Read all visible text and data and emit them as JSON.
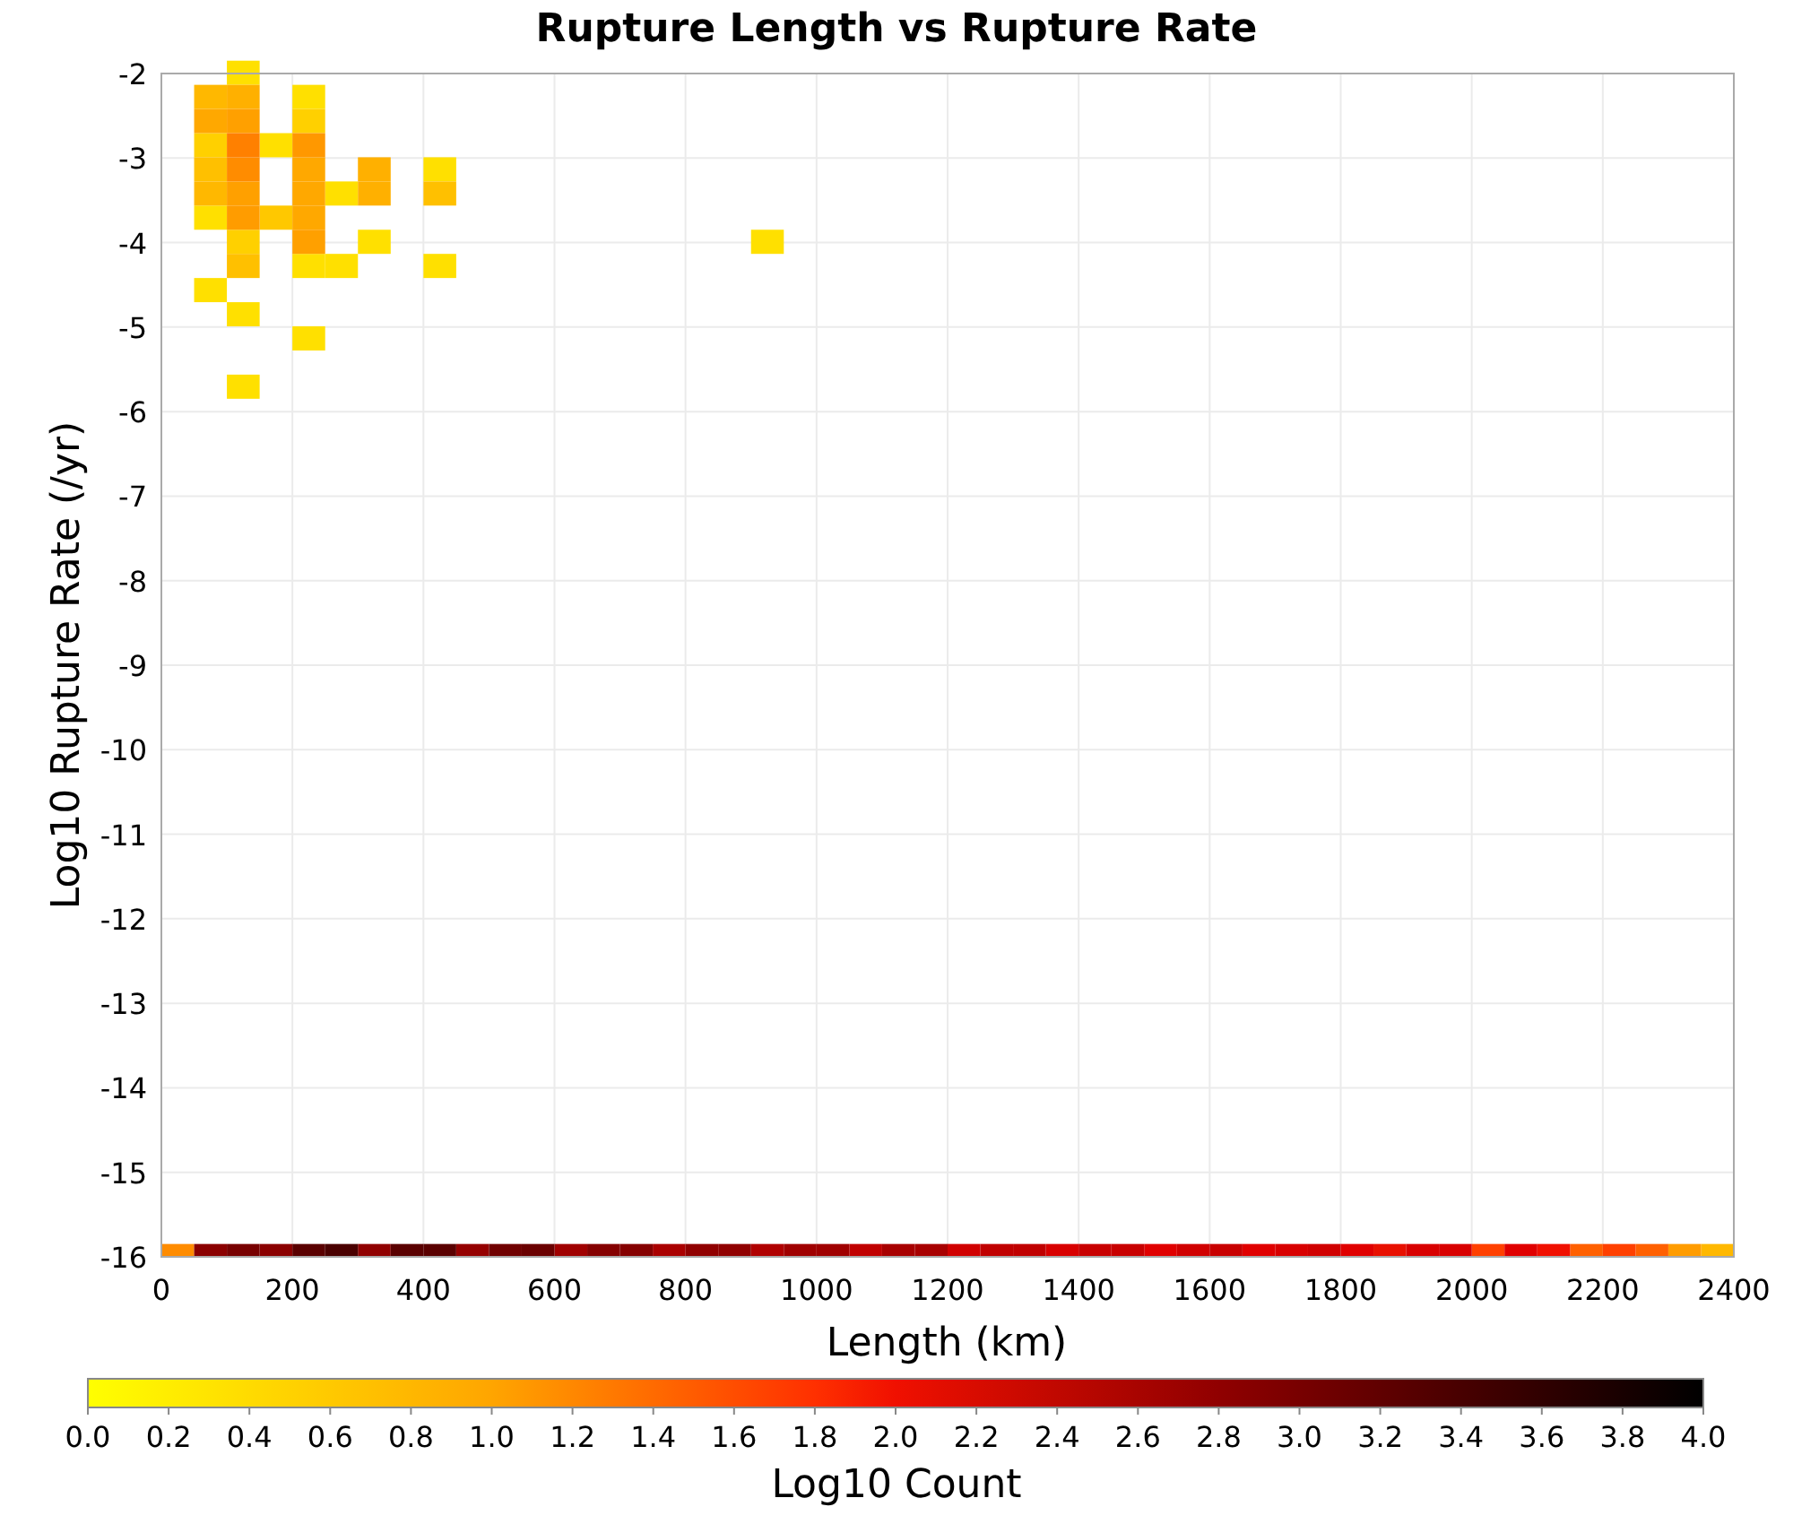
{
  "chart_data": {
    "type": "scatter",
    "title": "Rupture Length vs Rupture Rate",
    "xlabel": "Length (km)",
    "ylabel": "Log10 Rupture Rate (/yr)",
    "xlim": [
      0,
      2400
    ],
    "ylim": [
      -16,
      -2
    ],
    "grid": true,
    "xticks": [
      0,
      200,
      400,
      600,
      800,
      1000,
      1200,
      1400,
      1600,
      1800,
      2000,
      2200,
      2400
    ],
    "yticks": [
      -2,
      -3,
      -4,
      -5,
      -6,
      -7,
      -8,
      -9,
      -10,
      -11,
      -12,
      -13,
      -14,
      -15,
      -16
    ],
    "x": [
      25,
      75,
      125,
      175,
      225,
      275,
      325,
      375,
      425,
      475,
      525,
      575,
      625,
      675,
      725,
      775,
      825,
      875,
      925,
      975,
      1025,
      1075,
      1125,
      1175,
      1225,
      1275,
      1325,
      1375,
      1425,
      1475,
      1525,
      1575,
      1625,
      1675,
      1725,
      1775,
      1825,
      1875,
      1925,
      1975,
      2025,
      2075,
      2125,
      2175,
      2225,
      2275,
      2325,
      2375
    ],
    "series": [
      {
        "color": "#ffe000",
        "values": [
          null,
          -3.71,
          -2,
          -2.85,
          -2.28,
          -3.42,
          -3.99,
          null,
          -3.13,
          null,
          null,
          null,
          null,
          null,
          null,
          null,
          null,
          null,
          -3.99,
          null,
          null,
          null,
          null,
          null,
          null,
          null,
          null,
          null,
          null,
          null,
          null,
          null,
          null,
          null,
          null,
          null,
          null,
          null,
          null,
          null,
          null,
          null,
          null,
          null,
          null,
          null,
          null,
          null
        ]
      },
      {
        "color": "#ffe000",
        "values": [
          null,
          -4.56,
          -4.85,
          null,
          -4.28,
          -4.28,
          null,
          null,
          -4.28,
          null,
          null,
          null,
          null,
          null,
          null,
          null,
          null,
          null,
          null,
          null,
          null,
          null,
          null,
          null,
          null,
          null,
          null,
          null,
          null,
          null,
          null,
          null,
          null,
          null,
          null,
          null,
          null,
          null,
          null,
          null,
          null,
          null,
          null,
          null,
          null,
          null,
          null,
          null
        ]
      },
      {
        "color": "#ffe000",
        "values": [
          null,
          null,
          -5.7,
          null,
          -5.13,
          null,
          null,
          null,
          null,
          null,
          null,
          null,
          null,
          null,
          null,
          null,
          null,
          null,
          null,
          null,
          null,
          null,
          null,
          null,
          null,
          null,
          null,
          null,
          null,
          null,
          null,
          null,
          null,
          null,
          null,
          null,
          null,
          null,
          null,
          null,
          null,
          null,
          null,
          null,
          null,
          null,
          null,
          null
        ]
      },
      {
        "color": "#ffd000",
        "values": [
          null,
          -2.85,
          -3.99,
          null,
          -2.56,
          null,
          null,
          null,
          null,
          null,
          null,
          null,
          null,
          null,
          null,
          null,
          null,
          null,
          null,
          null,
          null,
          null,
          null,
          null,
          null,
          null,
          null,
          null,
          null,
          null,
          null,
          null,
          null,
          null,
          null,
          null,
          null,
          null,
          null,
          null,
          null,
          null,
          null,
          null,
          null,
          null,
          null,
          null
        ]
      },
      {
        "color": "#ffc800",
        "values": [
          null,
          null,
          null,
          -3.71,
          null,
          null,
          null,
          null,
          null,
          null,
          null,
          null,
          null,
          null,
          null,
          null,
          null,
          null,
          null,
          null,
          null,
          null,
          null,
          null,
          null,
          null,
          null,
          null,
          null,
          null,
          null,
          null,
          null,
          null,
          null,
          null,
          null,
          null,
          null,
          null,
          null,
          null,
          null,
          null,
          null,
          null,
          null,
          null
        ]
      },
      {
        "color": "#ffc000",
        "values": [
          null,
          -3.13,
          -4.28,
          null,
          null,
          null,
          null,
          null,
          -3.42,
          null,
          null,
          null,
          null,
          null,
          null,
          null,
          null,
          null,
          null,
          null,
          null,
          null,
          null,
          null,
          null,
          null,
          null,
          null,
          null,
          null,
          null,
          null,
          null,
          null,
          null,
          null,
          null,
          null,
          null,
          null,
          null,
          null,
          null,
          null,
          null,
          null,
          null,
          null
        ]
      },
      {
        "color": "#ffb800",
        "values": [
          null,
          -2.28,
          null,
          null,
          null,
          null,
          null,
          null,
          null,
          null,
          null,
          null,
          null,
          null,
          null,
          null,
          null,
          null,
          null,
          null,
          null,
          null,
          null,
          null,
          null,
          null,
          null,
          null,
          null,
          null,
          null,
          null,
          null,
          null,
          null,
          null,
          null,
          null,
          null,
          null,
          null,
          null,
          null,
          null,
          null,
          null,
          null,
          -15.92
        ]
      },
      {
        "color": "#ffb800",
        "values": [
          null,
          -3.42,
          null,
          null,
          null,
          null,
          null,
          null,
          null,
          null,
          null,
          null,
          null,
          null,
          null,
          null,
          null,
          null,
          null,
          null,
          null,
          null,
          null,
          null,
          null,
          null,
          null,
          null,
          null,
          null,
          null,
          null,
          null,
          null,
          null,
          null,
          null,
          null,
          null,
          null,
          null,
          null,
          null,
          null,
          null,
          null,
          null,
          null
        ]
      },
      {
        "color": "#ffb000",
        "values": [
          null,
          null,
          -2.28,
          null,
          null,
          null,
          -3.13,
          null,
          null,
          null,
          null,
          null,
          null,
          null,
          null,
          null,
          null,
          null,
          null,
          null,
          null,
          null,
          null,
          null,
          null,
          null,
          null,
          null,
          null,
          null,
          null,
          null,
          null,
          null,
          null,
          null,
          null,
          null,
          null,
          null,
          null,
          null,
          null,
          null,
          null,
          null,
          null,
          null
        ]
      },
      {
        "color": "#ffb000",
        "values": [
          null,
          null,
          null,
          null,
          null,
          null,
          -3.42,
          null,
          null,
          null,
          null,
          null,
          null,
          null,
          null,
          null,
          null,
          null,
          null,
          null,
          null,
          null,
          null,
          null,
          null,
          null,
          null,
          null,
          null,
          null,
          null,
          null,
          null,
          null,
          null,
          null,
          null,
          null,
          null,
          null,
          null,
          null,
          null,
          null,
          null,
          null,
          null,
          null
        ]
      },
      {
        "color": "#ffa800",
        "values": [
          null,
          -2.56,
          null,
          null,
          -3.13,
          null,
          null,
          null,
          null,
          null,
          null,
          null,
          null,
          null,
          null,
          null,
          null,
          null,
          null,
          null,
          null,
          null,
          null,
          null,
          null,
          null,
          null,
          null,
          null,
          null,
          null,
          null,
          null,
          null,
          null,
          null,
          null,
          null,
          null,
          null,
          null,
          null,
          null,
          null,
          null,
          null,
          null,
          null
        ]
      },
      {
        "color": "#ffa800",
        "values": [
          null,
          null,
          null,
          null,
          -3.42,
          null,
          null,
          null,
          null,
          null,
          null,
          null,
          null,
          null,
          null,
          null,
          null,
          null,
          null,
          null,
          null,
          null,
          null,
          null,
          null,
          null,
          null,
          null,
          null,
          null,
          null,
          null,
          null,
          null,
          null,
          null,
          null,
          null,
          null,
          null,
          null,
          null,
          null,
          null,
          null,
          null,
          null,
          null
        ]
      },
      {
        "color": "#ffa800",
        "values": [
          null,
          null,
          null,
          null,
          -3.71,
          null,
          null,
          null,
          null,
          null,
          null,
          null,
          null,
          null,
          null,
          null,
          null,
          null,
          null,
          null,
          null,
          null,
          null,
          null,
          null,
          null,
          null,
          null,
          null,
          null,
          null,
          null,
          null,
          null,
          null,
          null,
          null,
          null,
          null,
          null,
          null,
          null,
          null,
          null,
          null,
          null,
          null,
          null
        ]
      },
      {
        "color": "#ffa000",
        "values": [
          null,
          null,
          -2.56,
          null,
          -3.99,
          null,
          null,
          null,
          null,
          null,
          null,
          null,
          null,
          null,
          null,
          null,
          null,
          null,
          null,
          null,
          null,
          null,
          null,
          null,
          null,
          null,
          null,
          null,
          null,
          null,
          null,
          null,
          null,
          null,
          null,
          null,
          null,
          null,
          null,
          null,
          null,
          null,
          null,
          null,
          null,
          null,
          null,
          null
        ]
      },
      {
        "color": "#ffa000",
        "values": [
          null,
          null,
          -3.42,
          null,
          null,
          null,
          null,
          null,
          null,
          null,
          null,
          null,
          null,
          null,
          null,
          null,
          null,
          null,
          null,
          null,
          null,
          null,
          null,
          null,
          null,
          null,
          null,
          null,
          null,
          null,
          null,
          null,
          null,
          null,
          null,
          null,
          null,
          null,
          null,
          null,
          null,
          null,
          null,
          null,
          null,
          null,
          null,
          null
        ]
      },
      {
        "color": "#ff9c00",
        "values": [
          null,
          null,
          -3.71,
          null,
          null,
          null,
          null,
          null,
          null,
          null,
          null,
          null,
          null,
          null,
          null,
          null,
          null,
          null,
          null,
          null,
          null,
          null,
          null,
          null,
          null,
          null,
          null,
          null,
          null,
          null,
          null,
          null,
          null,
          null,
          null,
          null,
          null,
          null,
          null,
          null,
          null,
          null,
          null,
          null,
          null,
          null,
          -15.92,
          null
        ]
      },
      {
        "color": "#ff9800",
        "values": [
          null,
          null,
          null,
          null,
          -2.85,
          null,
          null,
          null,
          null,
          null,
          null,
          null,
          null,
          null,
          null,
          null,
          null,
          null,
          null,
          null,
          null,
          null,
          null,
          null,
          null,
          null,
          null,
          null,
          null,
          null,
          null,
          null,
          null,
          null,
          null,
          null,
          null,
          null,
          null,
          null,
          null,
          null,
          null,
          null,
          null,
          null,
          null,
          null
        ]
      },
      {
        "color": "#ff8c00",
        "values": [
          -15.92,
          null,
          -3.13,
          null,
          null,
          null,
          null,
          null,
          null,
          null,
          null,
          null,
          null,
          null,
          null,
          null,
          null,
          null,
          null,
          null,
          null,
          null,
          null,
          null,
          null,
          null,
          null,
          null,
          null,
          null,
          null,
          null,
          null,
          null,
          null,
          null,
          null,
          null,
          null,
          null,
          null,
          null,
          null,
          null,
          null,
          null,
          null,
          null
        ]
      },
      {
        "color": "#ff8000",
        "values": [
          null,
          null,
          -2.85,
          null,
          null,
          null,
          null,
          null,
          null,
          null,
          null,
          null,
          null,
          null,
          null,
          null,
          null,
          null,
          null,
          null,
          null,
          null,
          null,
          null,
          null,
          null,
          null,
          null,
          null,
          null,
          null,
          null,
          null,
          null,
          null,
          null,
          null,
          null,
          null,
          null,
          null,
          null,
          null,
          null,
          null,
          null,
          null,
          null
        ]
      },
      {
        "color": "#ff6000",
        "values": [
          null,
          null,
          null,
          null,
          null,
          null,
          null,
          null,
          null,
          null,
          null,
          null,
          null,
          null,
          null,
          null,
          null,
          null,
          null,
          null,
          null,
          null,
          null,
          null,
          null,
          null,
          null,
          null,
          null,
          null,
          null,
          null,
          null,
          null,
          null,
          null,
          null,
          null,
          null,
          null,
          null,
          null,
          null,
          -15.92,
          null,
          -15.92,
          null,
          null
        ]
      },
      {
        "color": "#ff4000",
        "values": [
          null,
          null,
          null,
          null,
          null,
          null,
          null,
          null,
          null,
          null,
          null,
          null,
          null,
          null,
          null,
          null,
          null,
          null,
          null,
          null,
          null,
          null,
          null,
          null,
          null,
          null,
          null,
          null,
          null,
          null,
          null,
          null,
          null,
          null,
          null,
          null,
          null,
          null,
          null,
          null,
          -15.92,
          null,
          null,
          null,
          -15.92,
          null,
          null,
          null
        ]
      },
      {
        "color": "#f01000",
        "values": [
          null,
          null,
          null,
          null,
          null,
          null,
          null,
          null,
          null,
          null,
          null,
          null,
          null,
          null,
          null,
          null,
          null,
          null,
          null,
          null,
          null,
          null,
          null,
          null,
          null,
          null,
          null,
          null,
          null,
          null,
          null,
          null,
          null,
          null,
          null,
          null,
          null,
          null,
          null,
          null,
          null,
          null,
          -15.92,
          null,
          null,
          null,
          null,
          null
        ]
      },
      {
        "color": "#e81000",
        "values": [
          null,
          null,
          null,
          null,
          null,
          null,
          null,
          null,
          null,
          null,
          null,
          null,
          null,
          null,
          null,
          null,
          null,
          null,
          null,
          null,
          null,
          null,
          null,
          null,
          null,
          null,
          null,
          null,
          null,
          null,
          null,
          null,
          null,
          null,
          null,
          null,
          null,
          -15.92,
          null,
          null,
          null,
          null,
          null,
          null,
          null,
          null,
          null,
          null
        ]
      },
      {
        "color": "#e00000",
        "values": [
          null,
          null,
          null,
          null,
          null,
          null,
          null,
          null,
          null,
          null,
          null,
          null,
          null,
          null,
          null,
          null,
          null,
          null,
          null,
          null,
          null,
          null,
          null,
          null,
          null,
          null,
          null,
          null,
          null,
          null,
          -15.92,
          null,
          null,
          -15.92,
          null,
          null,
          -15.92,
          null,
          null,
          null,
          null,
          -15.92,
          null,
          null,
          null,
          null,
          null,
          null
        ]
      },
      {
        "color": "#d80000",
        "values": [
          null,
          null,
          null,
          null,
          null,
          null,
          null,
          null,
          null,
          null,
          null,
          null,
          null,
          null,
          null,
          null,
          null,
          null,
          null,
          null,
          null,
          null,
          null,
          null,
          null,
          null,
          null,
          -15.92,
          null,
          null,
          null,
          null,
          null,
          null,
          -15.92,
          null,
          null,
          null,
          -15.92,
          -15.92,
          null,
          null,
          null,
          null,
          null,
          null,
          null,
          null
        ]
      },
      {
        "color": "#d00000",
        "values": [
          null,
          null,
          null,
          null,
          null,
          null,
          null,
          null,
          null,
          null,
          null,
          null,
          null,
          null,
          null,
          null,
          null,
          null,
          null,
          null,
          null,
          null,
          null,
          null,
          -15.92,
          null,
          null,
          null,
          null,
          null,
          null,
          -15.92,
          null,
          null,
          null,
          -15.92,
          null,
          null,
          null,
          null,
          null,
          null,
          null,
          null,
          null,
          null,
          null,
          null
        ]
      },
      {
        "color": "#c80000",
        "values": [
          null,
          null,
          null,
          null,
          null,
          null,
          null,
          null,
          null,
          null,
          null,
          null,
          null,
          null,
          null,
          null,
          null,
          null,
          null,
          null,
          null,
          null,
          null,
          null,
          null,
          null,
          null,
          null,
          -15.92,
          -15.92,
          null,
          null,
          -15.92,
          null,
          null,
          null,
          null,
          null,
          null,
          null,
          null,
          null,
          null,
          null,
          null,
          null,
          null,
          null
        ]
      },
      {
        "color": "#c00000",
        "values": [
          null,
          null,
          null,
          null,
          null,
          null,
          null,
          null,
          null,
          null,
          null,
          null,
          null,
          null,
          null,
          null,
          null,
          null,
          null,
          null,
          null,
          -15.92,
          null,
          null,
          null,
          -15.92,
          -15.92,
          null,
          null,
          null,
          null,
          null,
          null,
          null,
          null,
          null,
          null,
          null,
          null,
          null,
          null,
          null,
          null,
          null,
          null,
          null,
          null,
          null
        ]
      },
      {
        "color": "#b00000",
        "values": [
          null,
          null,
          null,
          null,
          null,
          null,
          null,
          null,
          null,
          null,
          null,
          null,
          null,
          null,
          null,
          null,
          null,
          null,
          -15.92,
          null,
          null,
          null,
          null,
          null,
          null,
          null,
          null,
          null,
          null,
          null,
          null,
          null,
          null,
          null,
          null,
          null,
          null,
          null,
          null,
          null,
          null,
          null,
          null,
          null,
          null,
          null,
          null,
          null
        ]
      },
      {
        "color": "#aa0000",
        "values": [
          null,
          null,
          null,
          null,
          null,
          null,
          null,
          null,
          null,
          null,
          null,
          null,
          null,
          null,
          null,
          -15.92,
          null,
          null,
          null,
          null,
          null,
          null,
          null,
          null,
          null,
          null,
          null,
          null,
          null,
          null,
          null,
          null,
          null,
          null,
          null,
          null,
          null,
          null,
          null,
          null,
          null,
          null,
          null,
          null,
          null,
          null,
          null,
          null
        ]
      },
      {
        "color": "#a80000",
        "values": [
          null,
          null,
          null,
          null,
          null,
          null,
          null,
          null,
          null,
          null,
          null,
          null,
          null,
          null,
          null,
          null,
          null,
          null,
          null,
          null,
          null,
          null,
          -15.92,
          -15.92,
          null,
          null,
          null,
          null,
          null,
          null,
          null,
          null,
          null,
          null,
          null,
          null,
          null,
          null,
          null,
          null,
          null,
          null,
          null,
          null,
          null,
          null,
          null,
          null
        ]
      },
      {
        "color": "#a00000",
        "values": [
          null,
          null,
          null,
          null,
          null,
          null,
          null,
          null,
          null,
          null,
          null,
          null,
          -15.92,
          null,
          null,
          null,
          null,
          null,
          null,
          -15.92,
          -15.92,
          null,
          null,
          null,
          null,
          null,
          null,
          null,
          null,
          null,
          null,
          null,
          null,
          null,
          null,
          null,
          null,
          null,
          null,
          null,
          null,
          null,
          null,
          null,
          null,
          null,
          null,
          null
        ]
      },
      {
        "color": "#950000",
        "values": [
          null,
          null,
          null,
          null,
          null,
          null,
          null,
          null,
          null,
          -15.92,
          null,
          null,
          null,
          null,
          null,
          null,
          null,
          null,
          null,
          null,
          null,
          null,
          null,
          null,
          null,
          null,
          null,
          null,
          null,
          null,
          null,
          null,
          null,
          null,
          null,
          null,
          null,
          null,
          null,
          null,
          null,
          null,
          null,
          null,
          null,
          null,
          null,
          null
        ]
      },
      {
        "color": "#900000",
        "values": [
          null,
          null,
          null,
          null,
          null,
          null,
          -15.92,
          null,
          null,
          null,
          null,
          null,
          null,
          null,
          null,
          null,
          -15.92,
          -15.92,
          null,
          null,
          null,
          null,
          null,
          null,
          null,
          null,
          null,
          null,
          null,
          null,
          null,
          null,
          null,
          null,
          null,
          null,
          null,
          null,
          null,
          null,
          null,
          null,
          null,
          null,
          null,
          null,
          null,
          null
        ]
      },
      {
        "color": "#8b0000",
        "values": [
          null,
          -15.92,
          null,
          -15.92,
          null,
          null,
          null,
          null,
          null,
          null,
          null,
          null,
          null,
          null,
          null,
          null,
          null,
          null,
          null,
          null,
          null,
          null,
          null,
          null,
          null,
          null,
          null,
          null,
          null,
          null,
          null,
          null,
          null,
          null,
          null,
          null,
          null,
          null,
          null,
          null,
          null,
          null,
          null,
          null,
          null,
          null,
          null,
          null
        ]
      },
      {
        "color": "#850000",
        "values": [
          null,
          null,
          null,
          null,
          null,
          null,
          null,
          null,
          null,
          null,
          null,
          null,
          null,
          -15.92,
          -15.92,
          null,
          null,
          null,
          null,
          null,
          null,
          null,
          null,
          null,
          null,
          null,
          null,
          null,
          null,
          null,
          null,
          null,
          null,
          null,
          null,
          null,
          null,
          null,
          null,
          null,
          null,
          null,
          null,
          null,
          null,
          null,
          null,
          null
        ]
      },
      {
        "color": "#780000",
        "values": [
          null,
          null,
          -15.92,
          null,
          null,
          null,
          null,
          null,
          null,
          null,
          null,
          null,
          null,
          null,
          null,
          null,
          null,
          null,
          null,
          null,
          null,
          null,
          null,
          null,
          null,
          null,
          null,
          null,
          null,
          null,
          null,
          null,
          null,
          null,
          null,
          null,
          null,
          null,
          null,
          null,
          null,
          null,
          null,
          null,
          null,
          null,
          null,
          null
        ]
      },
      {
        "color": "#700000",
        "values": [
          null,
          null,
          null,
          null,
          null,
          null,
          null,
          null,
          null,
          null,
          -15.92,
          null,
          null,
          null,
          null,
          null,
          null,
          null,
          null,
          null,
          null,
          null,
          null,
          null,
          null,
          null,
          null,
          null,
          null,
          null,
          null,
          null,
          null,
          null,
          null,
          null,
          null,
          null,
          null,
          null,
          null,
          null,
          null,
          null,
          null,
          null,
          null,
          null
        ]
      },
      {
        "color": "#6a0000",
        "values": [
          null,
          null,
          null,
          null,
          null,
          null,
          null,
          null,
          null,
          null,
          null,
          -15.92,
          null,
          null,
          null,
          null,
          null,
          null,
          null,
          null,
          null,
          null,
          null,
          null,
          null,
          null,
          null,
          null,
          null,
          null,
          null,
          null,
          null,
          null,
          null,
          null,
          null,
          null,
          null,
          null,
          null,
          null,
          null,
          null,
          null,
          null,
          null,
          null
        ]
      },
      {
        "color": "#5a0000",
        "values": [
          null,
          null,
          null,
          null,
          -15.92,
          null,
          null,
          -15.92,
          -15.92,
          null,
          null,
          null,
          null,
          null,
          null,
          null,
          null,
          null,
          null,
          null,
          null,
          null,
          null,
          null,
          null,
          null,
          null,
          null,
          null,
          null,
          null,
          null,
          null,
          null,
          null,
          null,
          null,
          null,
          null,
          null,
          null,
          null,
          null,
          null,
          null,
          null,
          null,
          null
        ]
      },
      {
        "color": "#4a0000",
        "values": [
          null,
          null,
          null,
          null,
          null,
          -15.92,
          null,
          null,
          null,
          null,
          null,
          null,
          null,
          null,
          null,
          null,
          null,
          null,
          null,
          null,
          null,
          null,
          null,
          null,
          null,
          null,
          null,
          null,
          null,
          null,
          null,
          null,
          null,
          null,
          null,
          null,
          null,
          null,
          null,
          null,
          null,
          null,
          null,
          null,
          null,
          null,
          null,
          null
        ]
      }
    ]
  },
  "color_scale": {
    "title": "Log10 Count",
    "ticks": [
      "0.0",
      "0.2",
      "0.4",
      "0.6",
      "0.8",
      "1.0",
      "1.2",
      "1.4",
      "1.6",
      "1.8",
      "2.0",
      "2.2",
      "2.4",
      "2.6",
      "2.8",
      "3.0",
      "3.2",
      "3.4",
      "3.6",
      "3.8",
      "4.0"
    ]
  }
}
